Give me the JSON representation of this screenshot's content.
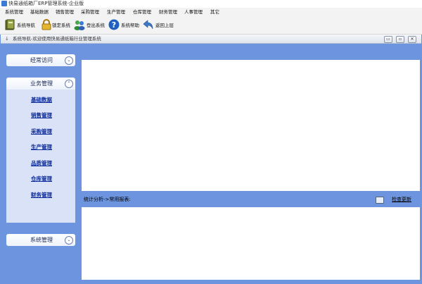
{
  "window": {
    "title": "快易通纸箱厂ERP管理系统-企业版"
  },
  "menu": [
    "系统管理",
    "基础数据",
    "销售管理",
    "采购管理",
    "生产管理",
    "仓库管理",
    "财务管理",
    "人事管理",
    "其它"
  ],
  "toolbar": [
    {
      "label": "系统导航",
      "icon": "book-icon"
    },
    {
      "label": "锁定系统",
      "icon": "lock-icon"
    },
    {
      "label": "登出系统",
      "icon": "users-icon"
    },
    {
      "label": "系统帮助",
      "icon": "help-icon"
    },
    {
      "label": "返回上层",
      "icon": "back-arrow-icon"
    }
  ],
  "inner_window": {
    "title": "系统导航-欢迎使用快易通纸箱行业管理系统",
    "buttons": [
      "▭",
      "▫",
      "✕"
    ]
  },
  "sidebar": {
    "frequent": {
      "label": "经常访问"
    },
    "business": {
      "label": "业务管理",
      "links": [
        "基础数据",
        "销售管理",
        "采购管理",
        "生产管理",
        "品质管理",
        "仓库管理",
        "财务管理"
      ]
    },
    "system": {
      "label": "系统管理"
    }
  },
  "stats": {
    "label": "统计分析->常用报表:",
    "link": "检查更新"
  }
}
